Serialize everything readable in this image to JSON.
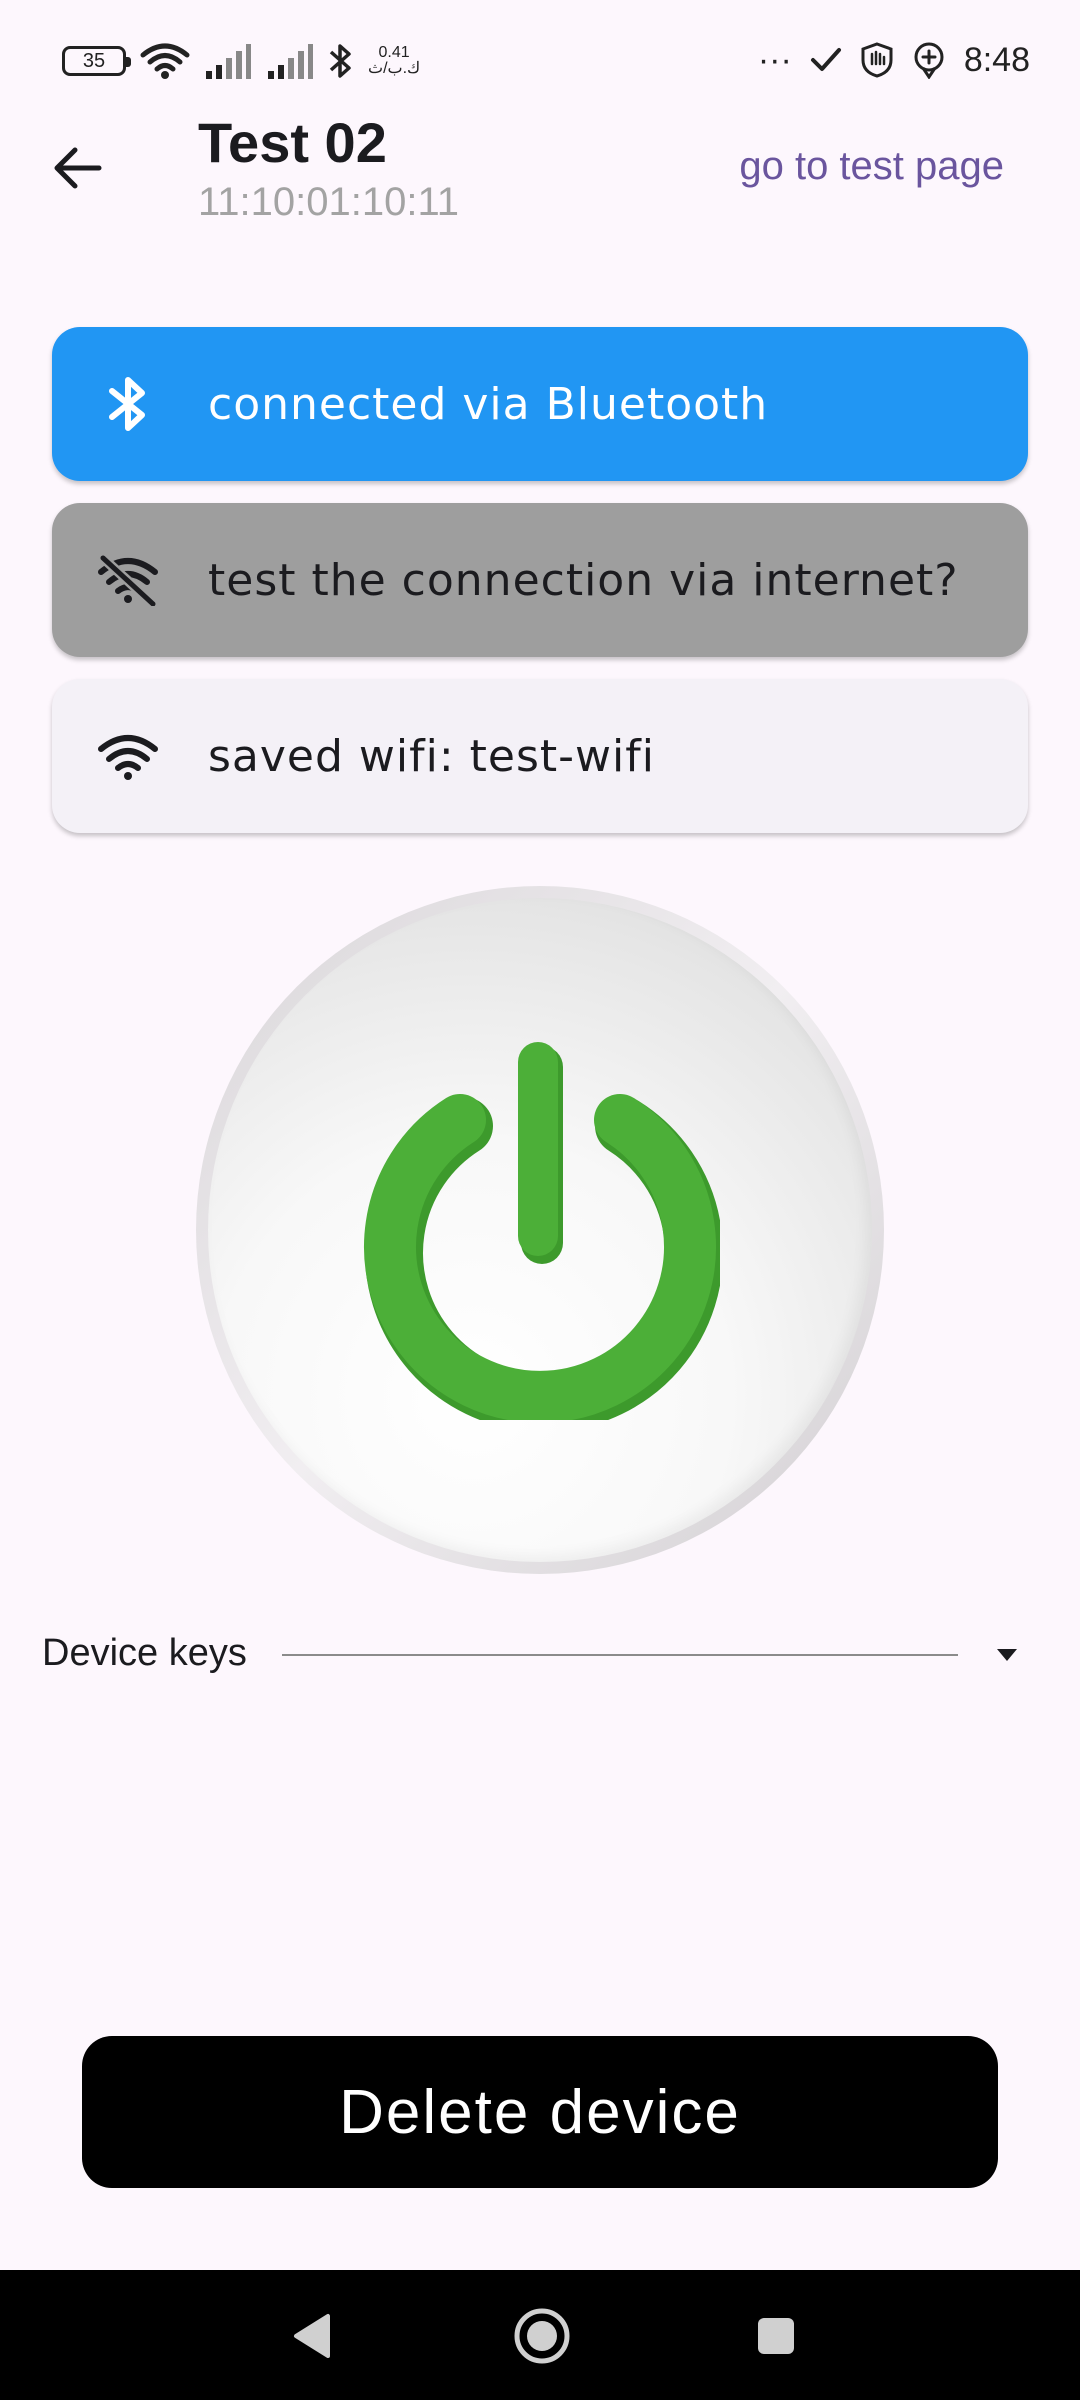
{
  "status_bar": {
    "battery": "35",
    "net_speed_value": "0.41",
    "net_speed_unit": "ك.ب/ث",
    "more": "···",
    "time": "8:48"
  },
  "app_bar": {
    "title": "Test 02",
    "subtitle": "11:10:01:10:11",
    "action_link": "go to test page"
  },
  "cards": {
    "bluetooth": "connected via Bluetooth",
    "internet": "test the connection via internet?",
    "wifi": "saved wifi: test-wifi"
  },
  "device_keys": {
    "label": "Device keys"
  },
  "delete_button": "Delete device",
  "colors": {
    "bluetooth_card": "#2196f3",
    "internet_card": "#9e9e9e",
    "wifi_card": "#f4f1f7",
    "power_green": "#4caf38",
    "link": "#6a559e",
    "background": "#fdf7fd"
  }
}
